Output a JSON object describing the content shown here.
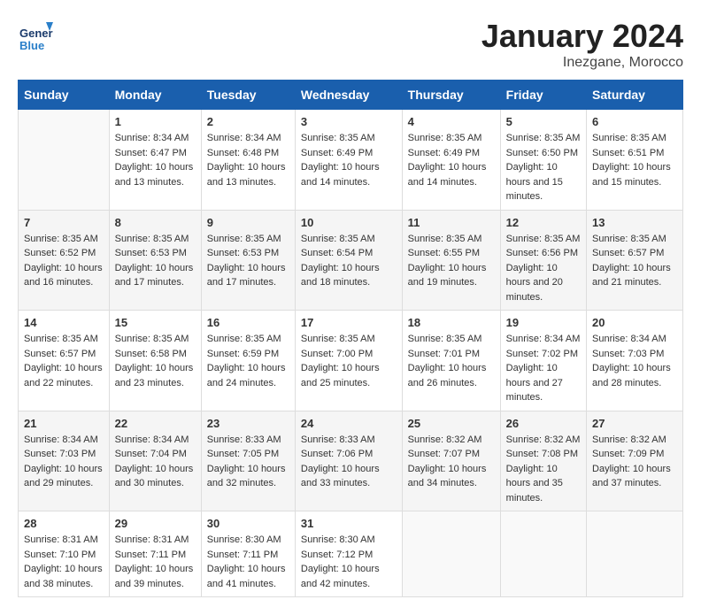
{
  "logo": {
    "general": "General",
    "blue": "Blue"
  },
  "title": "January 2024",
  "location": "Inezgane, Morocco",
  "days_of_week": [
    "Sunday",
    "Monday",
    "Tuesday",
    "Wednesday",
    "Thursday",
    "Friday",
    "Saturday"
  ],
  "weeks": [
    [
      {
        "day": "",
        "sunrise": "",
        "sunset": "",
        "daylight": ""
      },
      {
        "day": "1",
        "sunrise": "8:34 AM",
        "sunset": "6:47 PM",
        "daylight": "10 hours and 13 minutes."
      },
      {
        "day": "2",
        "sunrise": "8:34 AM",
        "sunset": "6:48 PM",
        "daylight": "10 hours and 13 minutes."
      },
      {
        "day": "3",
        "sunrise": "8:35 AM",
        "sunset": "6:49 PM",
        "daylight": "10 hours and 14 minutes."
      },
      {
        "day": "4",
        "sunrise": "8:35 AM",
        "sunset": "6:49 PM",
        "daylight": "10 hours and 14 minutes."
      },
      {
        "day": "5",
        "sunrise": "8:35 AM",
        "sunset": "6:50 PM",
        "daylight": "10 hours and 15 minutes."
      },
      {
        "day": "6",
        "sunrise": "8:35 AM",
        "sunset": "6:51 PM",
        "daylight": "10 hours and 15 minutes."
      }
    ],
    [
      {
        "day": "7",
        "sunrise": "8:35 AM",
        "sunset": "6:52 PM",
        "daylight": "10 hours and 16 minutes."
      },
      {
        "day": "8",
        "sunrise": "8:35 AM",
        "sunset": "6:53 PM",
        "daylight": "10 hours and 17 minutes."
      },
      {
        "day": "9",
        "sunrise": "8:35 AM",
        "sunset": "6:53 PM",
        "daylight": "10 hours and 17 minutes."
      },
      {
        "day": "10",
        "sunrise": "8:35 AM",
        "sunset": "6:54 PM",
        "daylight": "10 hours and 18 minutes."
      },
      {
        "day": "11",
        "sunrise": "8:35 AM",
        "sunset": "6:55 PM",
        "daylight": "10 hours and 19 minutes."
      },
      {
        "day": "12",
        "sunrise": "8:35 AM",
        "sunset": "6:56 PM",
        "daylight": "10 hours and 20 minutes."
      },
      {
        "day": "13",
        "sunrise": "8:35 AM",
        "sunset": "6:57 PM",
        "daylight": "10 hours and 21 minutes."
      }
    ],
    [
      {
        "day": "14",
        "sunrise": "8:35 AM",
        "sunset": "6:57 PM",
        "daylight": "10 hours and 22 minutes."
      },
      {
        "day": "15",
        "sunrise": "8:35 AM",
        "sunset": "6:58 PM",
        "daylight": "10 hours and 23 minutes."
      },
      {
        "day": "16",
        "sunrise": "8:35 AM",
        "sunset": "6:59 PM",
        "daylight": "10 hours and 24 minutes."
      },
      {
        "day": "17",
        "sunrise": "8:35 AM",
        "sunset": "7:00 PM",
        "daylight": "10 hours and 25 minutes."
      },
      {
        "day": "18",
        "sunrise": "8:35 AM",
        "sunset": "7:01 PM",
        "daylight": "10 hours and 26 minutes."
      },
      {
        "day": "19",
        "sunrise": "8:34 AM",
        "sunset": "7:02 PM",
        "daylight": "10 hours and 27 minutes."
      },
      {
        "day": "20",
        "sunrise": "8:34 AM",
        "sunset": "7:03 PM",
        "daylight": "10 hours and 28 minutes."
      }
    ],
    [
      {
        "day": "21",
        "sunrise": "8:34 AM",
        "sunset": "7:03 PM",
        "daylight": "10 hours and 29 minutes."
      },
      {
        "day": "22",
        "sunrise": "8:34 AM",
        "sunset": "7:04 PM",
        "daylight": "10 hours and 30 minutes."
      },
      {
        "day": "23",
        "sunrise": "8:33 AM",
        "sunset": "7:05 PM",
        "daylight": "10 hours and 32 minutes."
      },
      {
        "day": "24",
        "sunrise": "8:33 AM",
        "sunset": "7:06 PM",
        "daylight": "10 hours and 33 minutes."
      },
      {
        "day": "25",
        "sunrise": "8:32 AM",
        "sunset": "7:07 PM",
        "daylight": "10 hours and 34 minutes."
      },
      {
        "day": "26",
        "sunrise": "8:32 AM",
        "sunset": "7:08 PM",
        "daylight": "10 hours and 35 minutes."
      },
      {
        "day": "27",
        "sunrise": "8:32 AM",
        "sunset": "7:09 PM",
        "daylight": "10 hours and 37 minutes."
      }
    ],
    [
      {
        "day": "28",
        "sunrise": "8:31 AM",
        "sunset": "7:10 PM",
        "daylight": "10 hours and 38 minutes."
      },
      {
        "day": "29",
        "sunrise": "8:31 AM",
        "sunset": "7:11 PM",
        "daylight": "10 hours and 39 minutes."
      },
      {
        "day": "30",
        "sunrise": "8:30 AM",
        "sunset": "7:11 PM",
        "daylight": "10 hours and 41 minutes."
      },
      {
        "day": "31",
        "sunrise": "8:30 AM",
        "sunset": "7:12 PM",
        "daylight": "10 hours and 42 minutes."
      },
      {
        "day": "",
        "sunrise": "",
        "sunset": "",
        "daylight": ""
      },
      {
        "day": "",
        "sunrise": "",
        "sunset": "",
        "daylight": ""
      },
      {
        "day": "",
        "sunrise": "",
        "sunset": "",
        "daylight": ""
      }
    ]
  ]
}
